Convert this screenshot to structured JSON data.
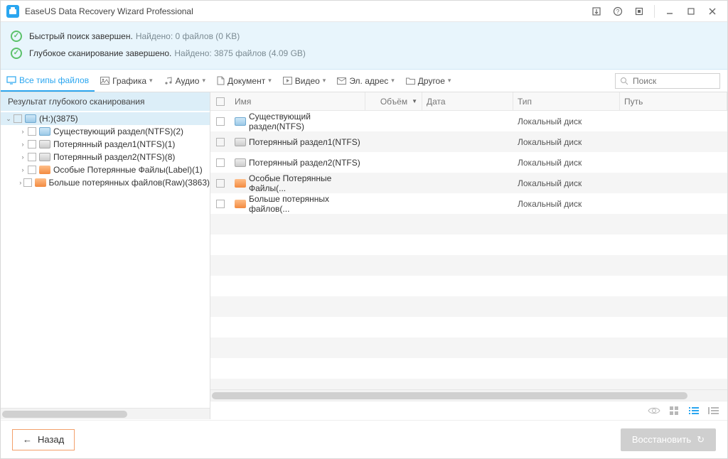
{
  "window": {
    "title": "EaseUS Data Recovery Wizard Professional"
  },
  "status": {
    "quick": {
      "main": "Быстрый поиск завершен.",
      "sub": "Найдено: 0 файлов (0 KB)"
    },
    "deep": {
      "main": "Глубокое сканирование завершено.",
      "sub": "Найдено: 3875 файлов (4.09 GB)"
    }
  },
  "filters": {
    "all": "Все типы файлов",
    "items": [
      {
        "label": "Графика"
      },
      {
        "label": "Аудио"
      },
      {
        "label": "Документ"
      },
      {
        "label": "Видео"
      },
      {
        "label": "Эл. адрес"
      },
      {
        "label": "Другое"
      }
    ]
  },
  "search": {
    "placeholder": "Поиск"
  },
  "sidebar": {
    "header": "Результат глубокого сканирования",
    "root": "(H:)(3875)",
    "children": [
      "Существующий раздел(NTFS)(2)",
      "Потерянный раздел1(NTFS)(1)",
      "Потерянный раздел2(NTFS)(8)",
      "Особые Потерянные Файлы(Label)(1)",
      "Больше потерянных файлов(Raw)(3863)"
    ]
  },
  "columns": {
    "name": "Имя",
    "size": "Объём",
    "date": "Дата",
    "type": "Тип",
    "path": "Путь"
  },
  "rows": [
    {
      "name": "Существующий раздел(NTFS)",
      "type": "Локальный диск",
      "icon": "disk"
    },
    {
      "name": "Потерянный раздел1(NTFS)",
      "type": "Локальный диск",
      "icon": "part"
    },
    {
      "name": "Потерянный раздел2(NTFS)",
      "type": "Локальный диск",
      "icon": "part"
    },
    {
      "name": "Особые Потерянные Файлы(...",
      "type": "Локальный диск",
      "icon": "lost"
    },
    {
      "name": "Больше потерянных файлов(...",
      "type": "Локальный диск",
      "icon": "lost"
    }
  ],
  "footer": {
    "back": "Назад",
    "recover": "Восстановить"
  }
}
